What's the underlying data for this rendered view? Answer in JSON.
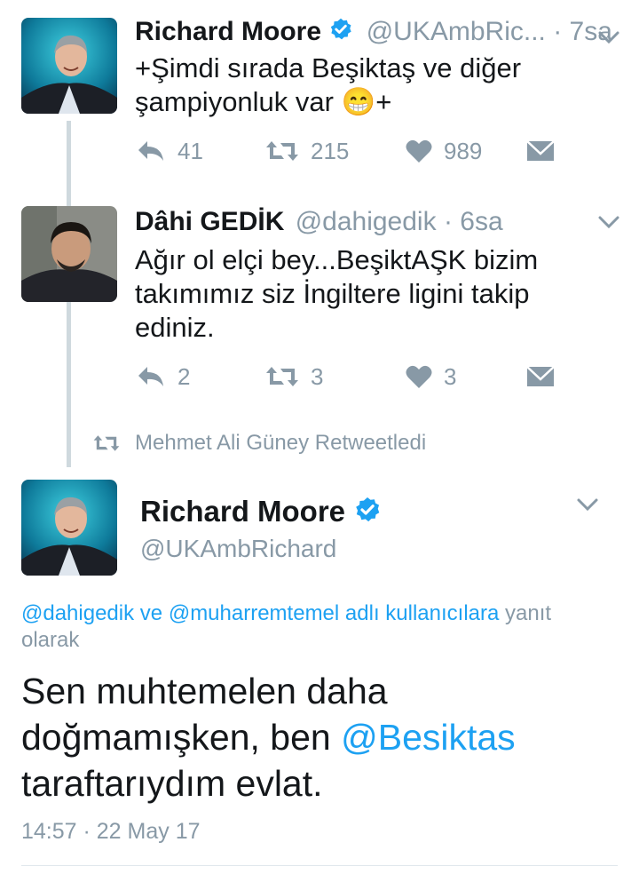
{
  "tweet1": {
    "name": "Richard Moore",
    "handle": "@UKAmbRic...",
    "time": "· 7sa",
    "text_line1": "+Şimdi sırada Beşiktaş ve diğer",
    "text_line2a": "şampiyonluk var",
    "emoji": "😁",
    "text_line2b": "+",
    "replies": "41",
    "retweets": "215",
    "likes": "989"
  },
  "tweet2": {
    "name": "Dâhi GEDİK",
    "handle": "@dahigedik",
    "time": "· 6sa",
    "text_line1": "Ağır ol elçi bey...BeşiktAŞK bizim",
    "text_line2": "takımımız siz İngiltere ligini takip",
    "text_line3": "ediniz.",
    "replies": "2",
    "retweets": "3",
    "likes": "3"
  },
  "retweet_context": {
    "text": "Mehmet Ali Güney Retweetledi"
  },
  "main_tweet": {
    "name": "Richard Moore",
    "handle": "@UKAmbRichard",
    "reply_to_user1": "@dahigedik",
    "reply_ve": "ve",
    "reply_to_user2": "@muharremtemel",
    "reply_adli": "adlı kullanıcılara",
    "reply_suffix1": "yanıt",
    "reply_suffix2": "olarak",
    "text_line1": "Sen muhtemelen daha",
    "text_line2a": "doğmamışken, ben",
    "text_line2_mention": "@Besiktas",
    "text_line3": "taraftarıydım evlat.",
    "timestamp": "14:57 · 22 May 17"
  },
  "icons": {
    "reply": "reply-icon",
    "retweet": "retweet-icon",
    "like": "heart-icon",
    "dm": "envelope-icon",
    "verified": "verified-badge-icon",
    "chevron": "chevron-down-icon"
  },
  "colors": {
    "accent": "#1da1f2",
    "gray": "#8899a6",
    "text": "#14171a",
    "thread_line": "#cfd9de"
  }
}
